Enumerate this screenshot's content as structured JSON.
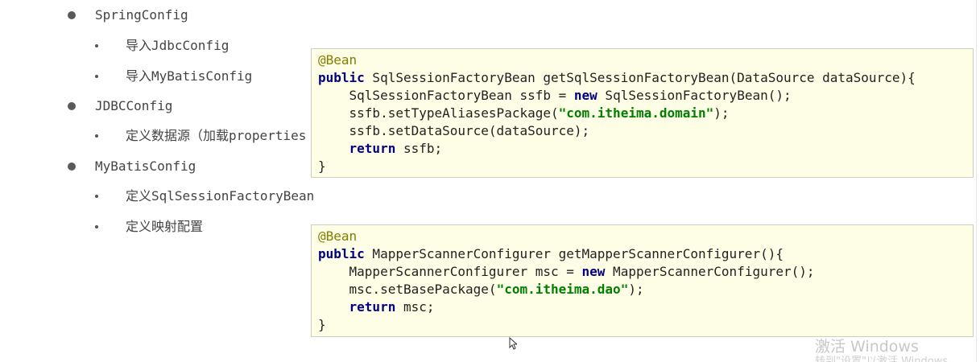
{
  "outline": {
    "spring_config": "SpringConfig",
    "import_jdbc": "导入JdbcConfig",
    "import_mybatis": "导入MyBatisConfig",
    "jdbc_config": "JDBCConfig",
    "define_datasource": "定义数据源（加载properties",
    "mybatis_config": "MyBatisConfig",
    "define_sqlsessionfactory": "定义SqlSessionFactoryBean",
    "define_mapping": "定义映射配置"
  },
  "code1": {
    "annotation": "@Bean",
    "kw_public": "public",
    "sig_rest": " SqlSessionFactoryBean getSqlSessionFactoryBean(DataSource dataSource){",
    "l3_pre": "    SqlSessionFactoryBean ssfb = ",
    "kw_new": "new",
    "l3_post": " SqlSessionFactoryBean();",
    "l4_pre": "    ssfb.setTypeAliasesPackage(",
    "l4_str": "\"com.itheima.domain\"",
    "l4_post": ");",
    "l5": "    ssfb.setDataSource(dataSource);",
    "l6_indent": "    ",
    "kw_return": "return",
    "l6_post": " ssfb;",
    "close": "}"
  },
  "code2": {
    "annotation": "@Bean",
    "kw_public": "public",
    "sig_rest": " MapperScannerConfigurer getMapperScannerConfigurer(){",
    "l3_pre": "    MapperScannerConfigurer msc = ",
    "kw_new": "new",
    "l3_post": " MapperScannerConfigurer();",
    "l4_pre": "    msc.setBasePackage(",
    "l4_str": "\"com.itheima.dao\"",
    "l4_post": ");",
    "l5_indent": "    ",
    "kw_return": "return",
    "l5_post": " msc;",
    "close": "}"
  },
  "watermark": {
    "title": "激活 Windows",
    "subtitle": "转到\"设置\"以激活 Windows。"
  }
}
